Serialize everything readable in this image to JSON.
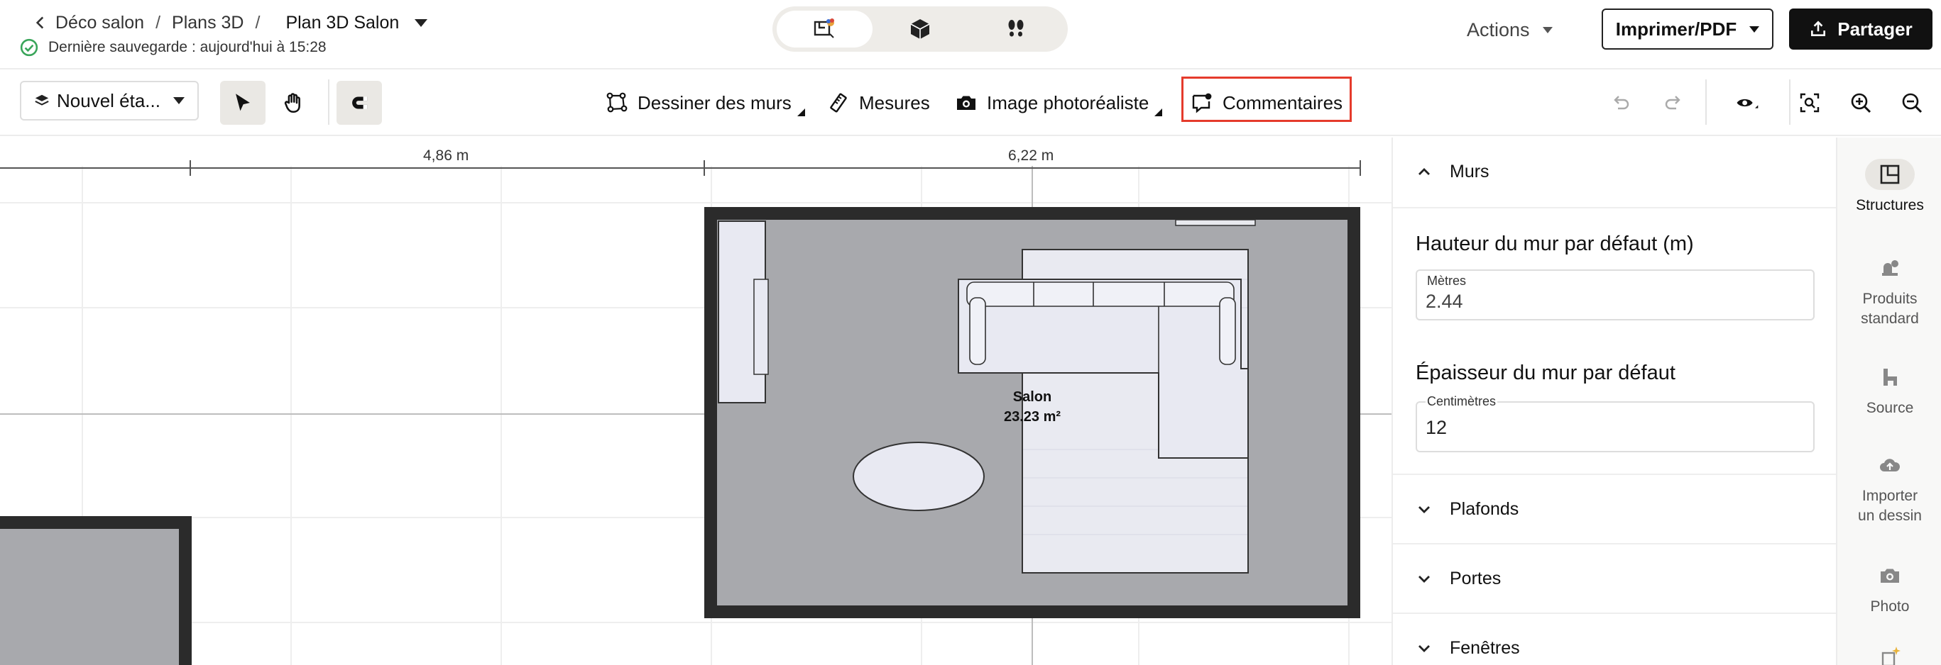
{
  "header": {
    "breadcrumbs": [
      "Déco salon",
      "Plans 3D"
    ],
    "current": "Plan 3D Salon",
    "save_status": "Dernière sauvegarde : aujourd'hui à 15:28",
    "view_modes": [
      "plan-2d-icon",
      "cube-3d-icon",
      "footsteps-icon"
    ],
    "actions_label": "Actions",
    "print_label": "Imprimer/PDF",
    "share_label": "Partager"
  },
  "toolbar": {
    "level_label": "Nouvel éta...",
    "draw_walls_label": "Dessiner des murs",
    "measures_label": "Mesures",
    "photo_label": "Image photoréaliste",
    "comments_label": "Commentaires",
    "highlight_color": "#e53b2c"
  },
  "canvas": {
    "dimension_left": "4,86 m",
    "dimension_right": "6,22 m",
    "room_name": "Salon",
    "room_area": "23.23 m²",
    "wall_color": "#2b2b2b",
    "floor_color": "#a8a9ad"
  },
  "panel": {
    "walls_title": "Murs",
    "height_title": "Hauteur du mur par défaut (m)",
    "height_unit": "Mètres",
    "height_value": "2.44",
    "thickness_title": "Épaisseur du mur par défaut",
    "thickness_unit": "Centimètres",
    "thickness_value": "12",
    "ceilings_title": "Plafonds",
    "doors_title": "Portes",
    "windows_title": "Fenêtres"
  },
  "rail": {
    "structures": "Structures",
    "products_1": "Produits",
    "products_2": "standard",
    "source": "Source",
    "import_1": "Importer",
    "import_2": "un dessin",
    "photo": "Photo"
  }
}
